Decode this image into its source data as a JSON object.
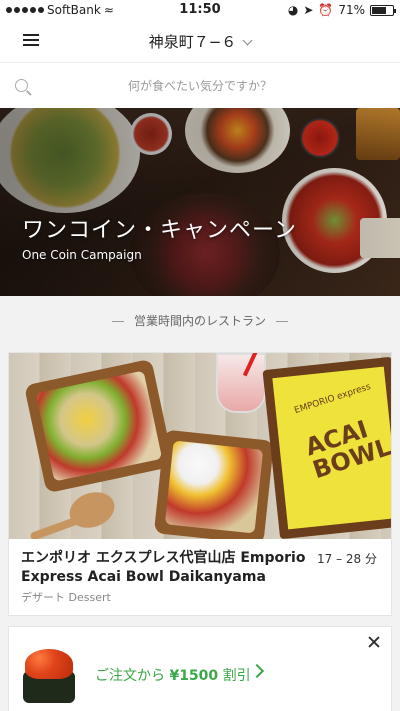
{
  "status": {
    "carrier": "SoftBank",
    "time": "11:50",
    "battery": "71%",
    "battery_level": 0.71
  },
  "nav": {
    "location": "神泉町７−６"
  },
  "search": {
    "placeholder": "何が食べたい気分ですか？"
  },
  "hero": {
    "title": "ワンコイン・キャンペーン",
    "subtitle": "One Coin Campaign"
  },
  "section": {
    "title": "営業時間内のレストラン"
  },
  "restaurant": {
    "name": "エンポリオ エクスプレス代官山店 Emporio Express Acai Bowl Daikanyama",
    "eta": "17 – 28 分",
    "category": "デザート Dessert",
    "sign_small": "EMPORIO express",
    "sign_big": "ACAI BOWL"
  },
  "promo": {
    "prefix": "ご注文から",
    "amount": "¥1500",
    "suffix": "割引"
  },
  "colors": {
    "accent_green": "#3ca84a"
  }
}
